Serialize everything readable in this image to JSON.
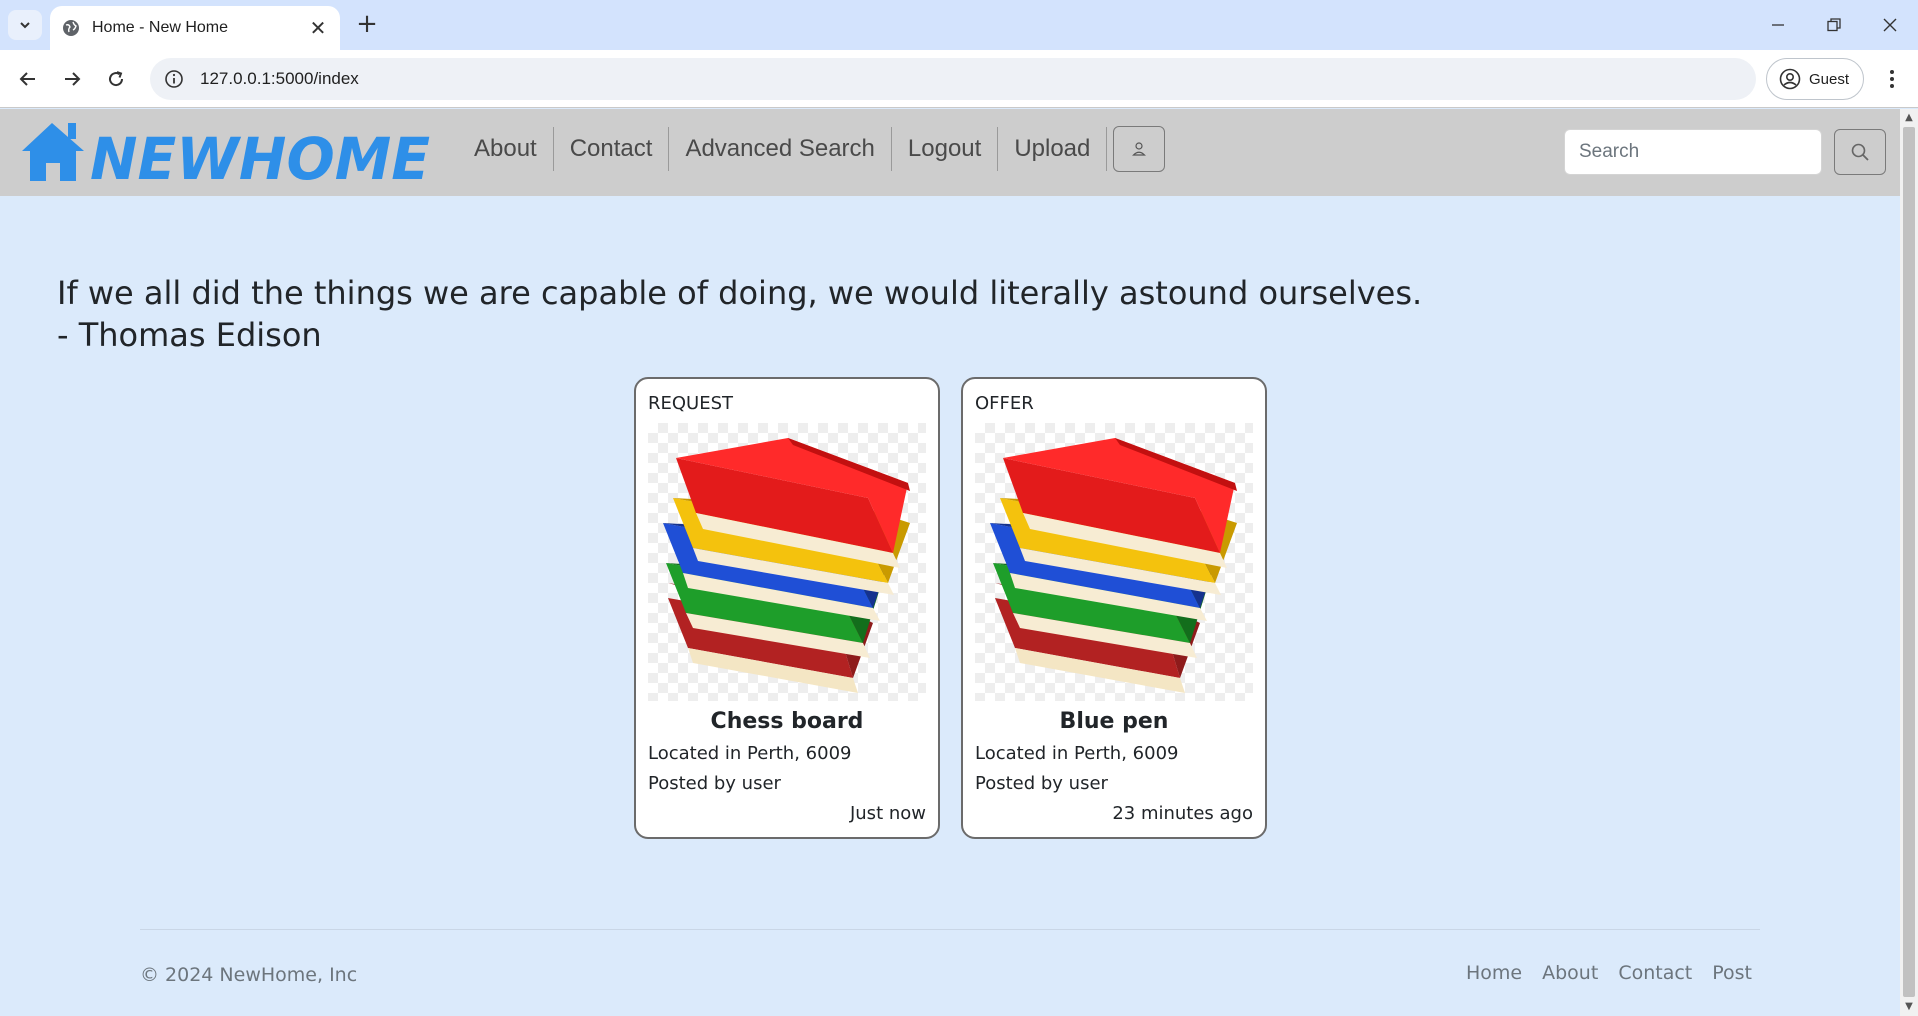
{
  "browser": {
    "tab_title": "Home - New Home",
    "url": "127.0.0.1:5000/index",
    "profile_label": "Guest"
  },
  "site": {
    "logo_text": "NEWHOME",
    "nav": [
      "About",
      "Contact",
      "Advanced Search",
      "Logout",
      "Upload"
    ],
    "search_placeholder": "Search",
    "brand_color": "#2e8fe8"
  },
  "quote": {
    "text": "If we all did the things we are capable of doing, we would literally astound ourselves.",
    "author": "- Thomas Edison"
  },
  "cards": [
    {
      "kind": "REQUEST",
      "image_icon": "books-stack-icon",
      "name": "Chess board",
      "location": "Located in Perth, 6009",
      "posted_by": "Posted by user",
      "time": "Just now"
    },
    {
      "kind": "OFFER",
      "image_icon": "books-stack-icon",
      "name": "Blue pen",
      "location": "Located in Perth, 6009",
      "posted_by": "Posted by user",
      "time": "23 minutes ago"
    }
  ],
  "footer": {
    "copyright": "© 2024 NewHome, Inc",
    "links": [
      "Home",
      "About",
      "Contact",
      "Post"
    ]
  }
}
